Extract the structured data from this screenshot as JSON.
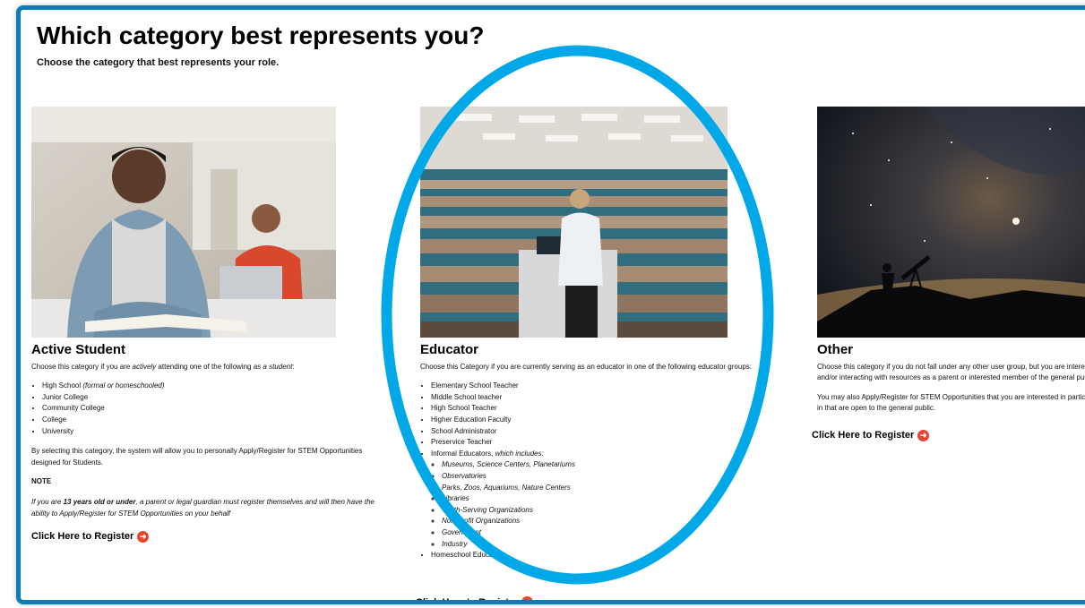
{
  "page": {
    "title": "Which category best represents you?",
    "subtitle": "Choose the category that best represents your role."
  },
  "student": {
    "heading": "Active Student",
    "intro_pre": "Choose this category if you are ",
    "intro_em": "actively",
    "intro_mid": " attending one of the following ",
    "intro_em2": "as a student",
    "intro_post": ":",
    "items": [
      {
        "text": "High School ",
        "em": "(formal or homeschooled)"
      },
      {
        "text": "Junior College",
        "em": ""
      },
      {
        "text": "Community College",
        "em": ""
      },
      {
        "text": "College",
        "em": ""
      },
      {
        "text": "University",
        "em": ""
      }
    ],
    "selection_note": "By selecting this category, the system will allow you to personally Apply/Register for STEM Opportunities designed for Students.",
    "note_label": "NOTE",
    "note_pre": "If you are ",
    "note_bold": "13 years old or under",
    "note_post": ", a parent or legal guardian must register themselves and will then have the ability to Apply/Register for STEM Opportunities on your behalf",
    "register_label": "Click Here to Register"
  },
  "educator": {
    "heading": "Educator",
    "intro": "Choose this Category if you are currently serving as an educator in one of the following educator groups:",
    "items": [
      "Elementary School Teacher",
      "Middle School teacher",
      "High School Teacher",
      "Higher Education Faculty",
      "School Administrator",
      "Preservice Teacher"
    ],
    "informal_label": "Informal Educators, ",
    "informal_em": "which includes:",
    "informal_items": [
      "Museums, Science Centers, Planetariums",
      "Observatories",
      "Parks, Zoos, Aquariums, Nature Centers",
      "Libraries",
      "Youth-Serving Organizations",
      "Non Profit Organizations",
      "Government",
      "Industry"
    ],
    "last_item": "Homeschool Educators",
    "register_label": "Click Here to Register"
  },
  "other": {
    "heading": "Other",
    "intro": "Choose this category if you do not fall under any other user group, but you are interested in and/or interacting with resources as a parent or interested member of the general public.",
    "para2": "You may also Apply/Register for STEM Opportunities that you are interested in participating in that are open to the general public.",
    "register_label": "Click Here to Register"
  },
  "icons": {
    "register": "arrow-right-circle-icon"
  },
  "colors": {
    "frame": "#0b7fb5",
    "highlight_ellipse": "#00a8e8",
    "register_icon": "#e8432f"
  }
}
